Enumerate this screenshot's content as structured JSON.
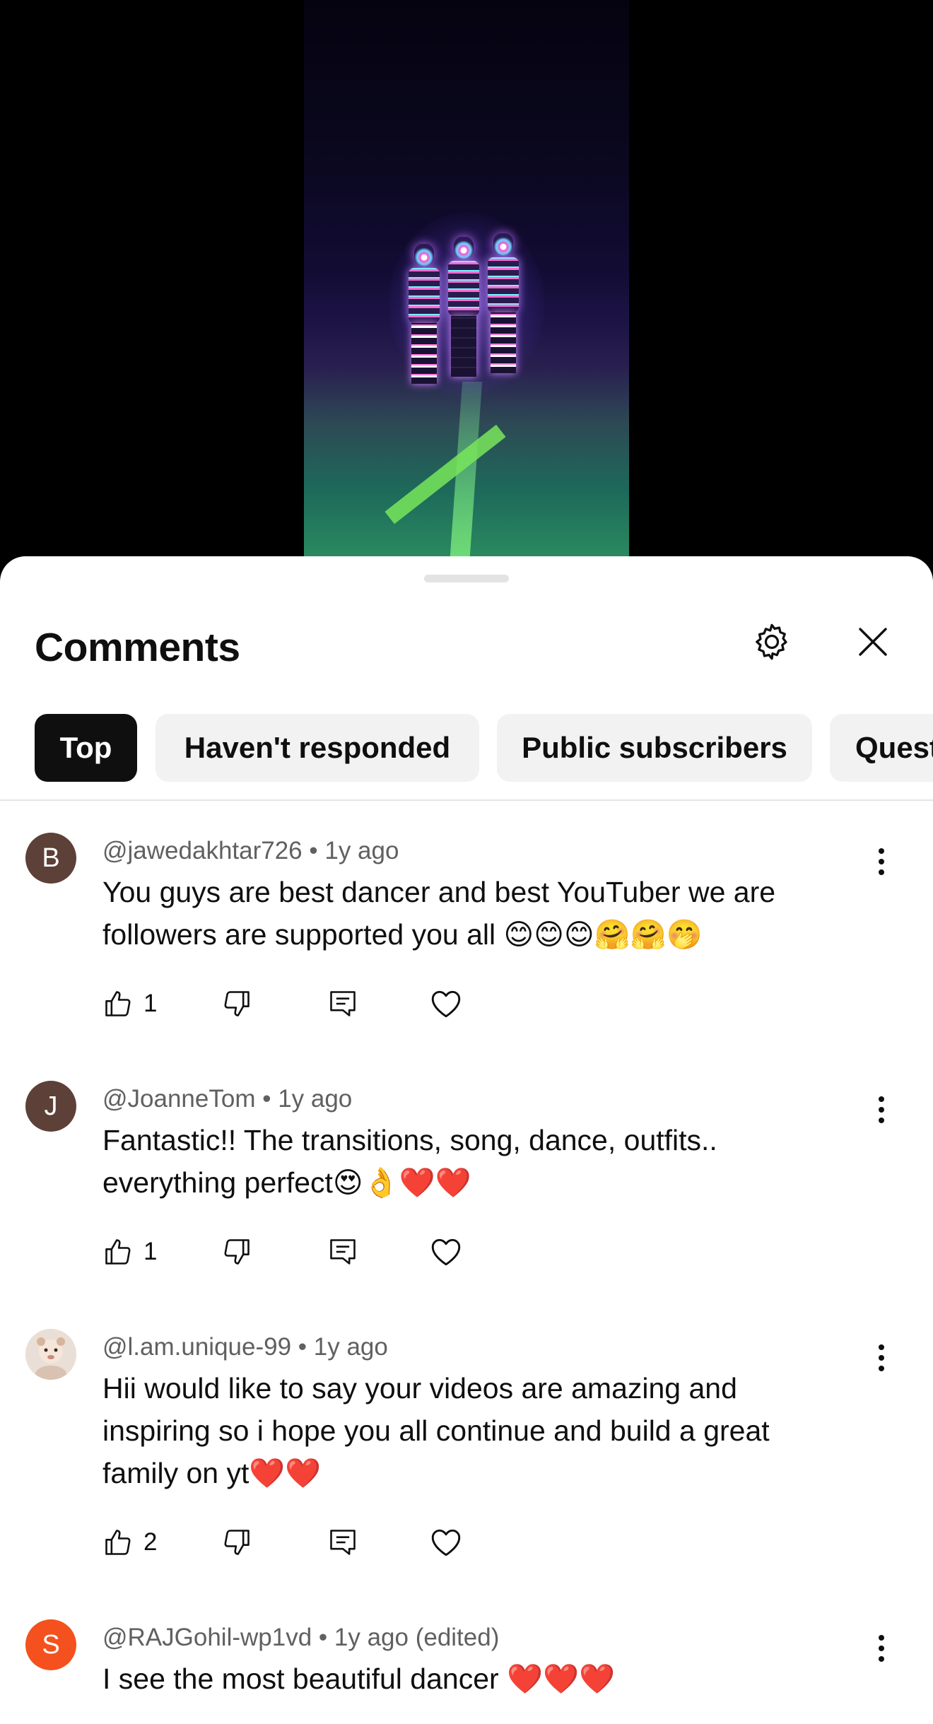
{
  "sheet": {
    "title": "Comments",
    "filters": [
      {
        "label": "Top",
        "active": true
      },
      {
        "label": "Haven't responded",
        "active": false
      },
      {
        "label": "Public subscribers",
        "active": false
      },
      {
        "label": "Questions",
        "active": false
      }
    ]
  },
  "comments": [
    {
      "avatar": "B",
      "avatar_color": "#5d4037",
      "author": "@jawedakhtar726",
      "time": "1y ago",
      "text": "You guys are best dancer and best YouTuber we are followers are supported you all 😊😊😊🤗🤗🤭",
      "likes": "1"
    },
    {
      "avatar": "J",
      "avatar_color": "#5d4037",
      "author": "@JoanneTom",
      "time": "1y ago",
      "text": "Fantastic!!  The transitions, song, dance, outfits.. everything perfect😍👌❤️❤️",
      "likes": "1"
    },
    {
      "avatar": "",
      "avatar_color": "#e8d6c8",
      "author": "@l.am.unique-99",
      "time": "1y ago",
      "text": "Hii would like to say your videos are amazing and inspiring so i hope you all continue and build a great family on yt❤️❤️",
      "likes": "2"
    },
    {
      "avatar": "S",
      "avatar_color": "#f4511e",
      "author": "@RAJGohil-wp1vd",
      "time": "1y ago (edited)",
      "text": "I see the most beautiful dancer ❤️❤️❤️",
      "likes": ""
    }
  ],
  "colors": {
    "chip_active": "#0f0f0f",
    "chip_bg": "#f2f2f2",
    "meta_text": "#606060"
  },
  "icons": [
    "settings-icon",
    "close-icon",
    "more-vert-icon",
    "thumb-up-icon",
    "thumb-down-icon",
    "reply-icon",
    "heart-icon"
  ]
}
